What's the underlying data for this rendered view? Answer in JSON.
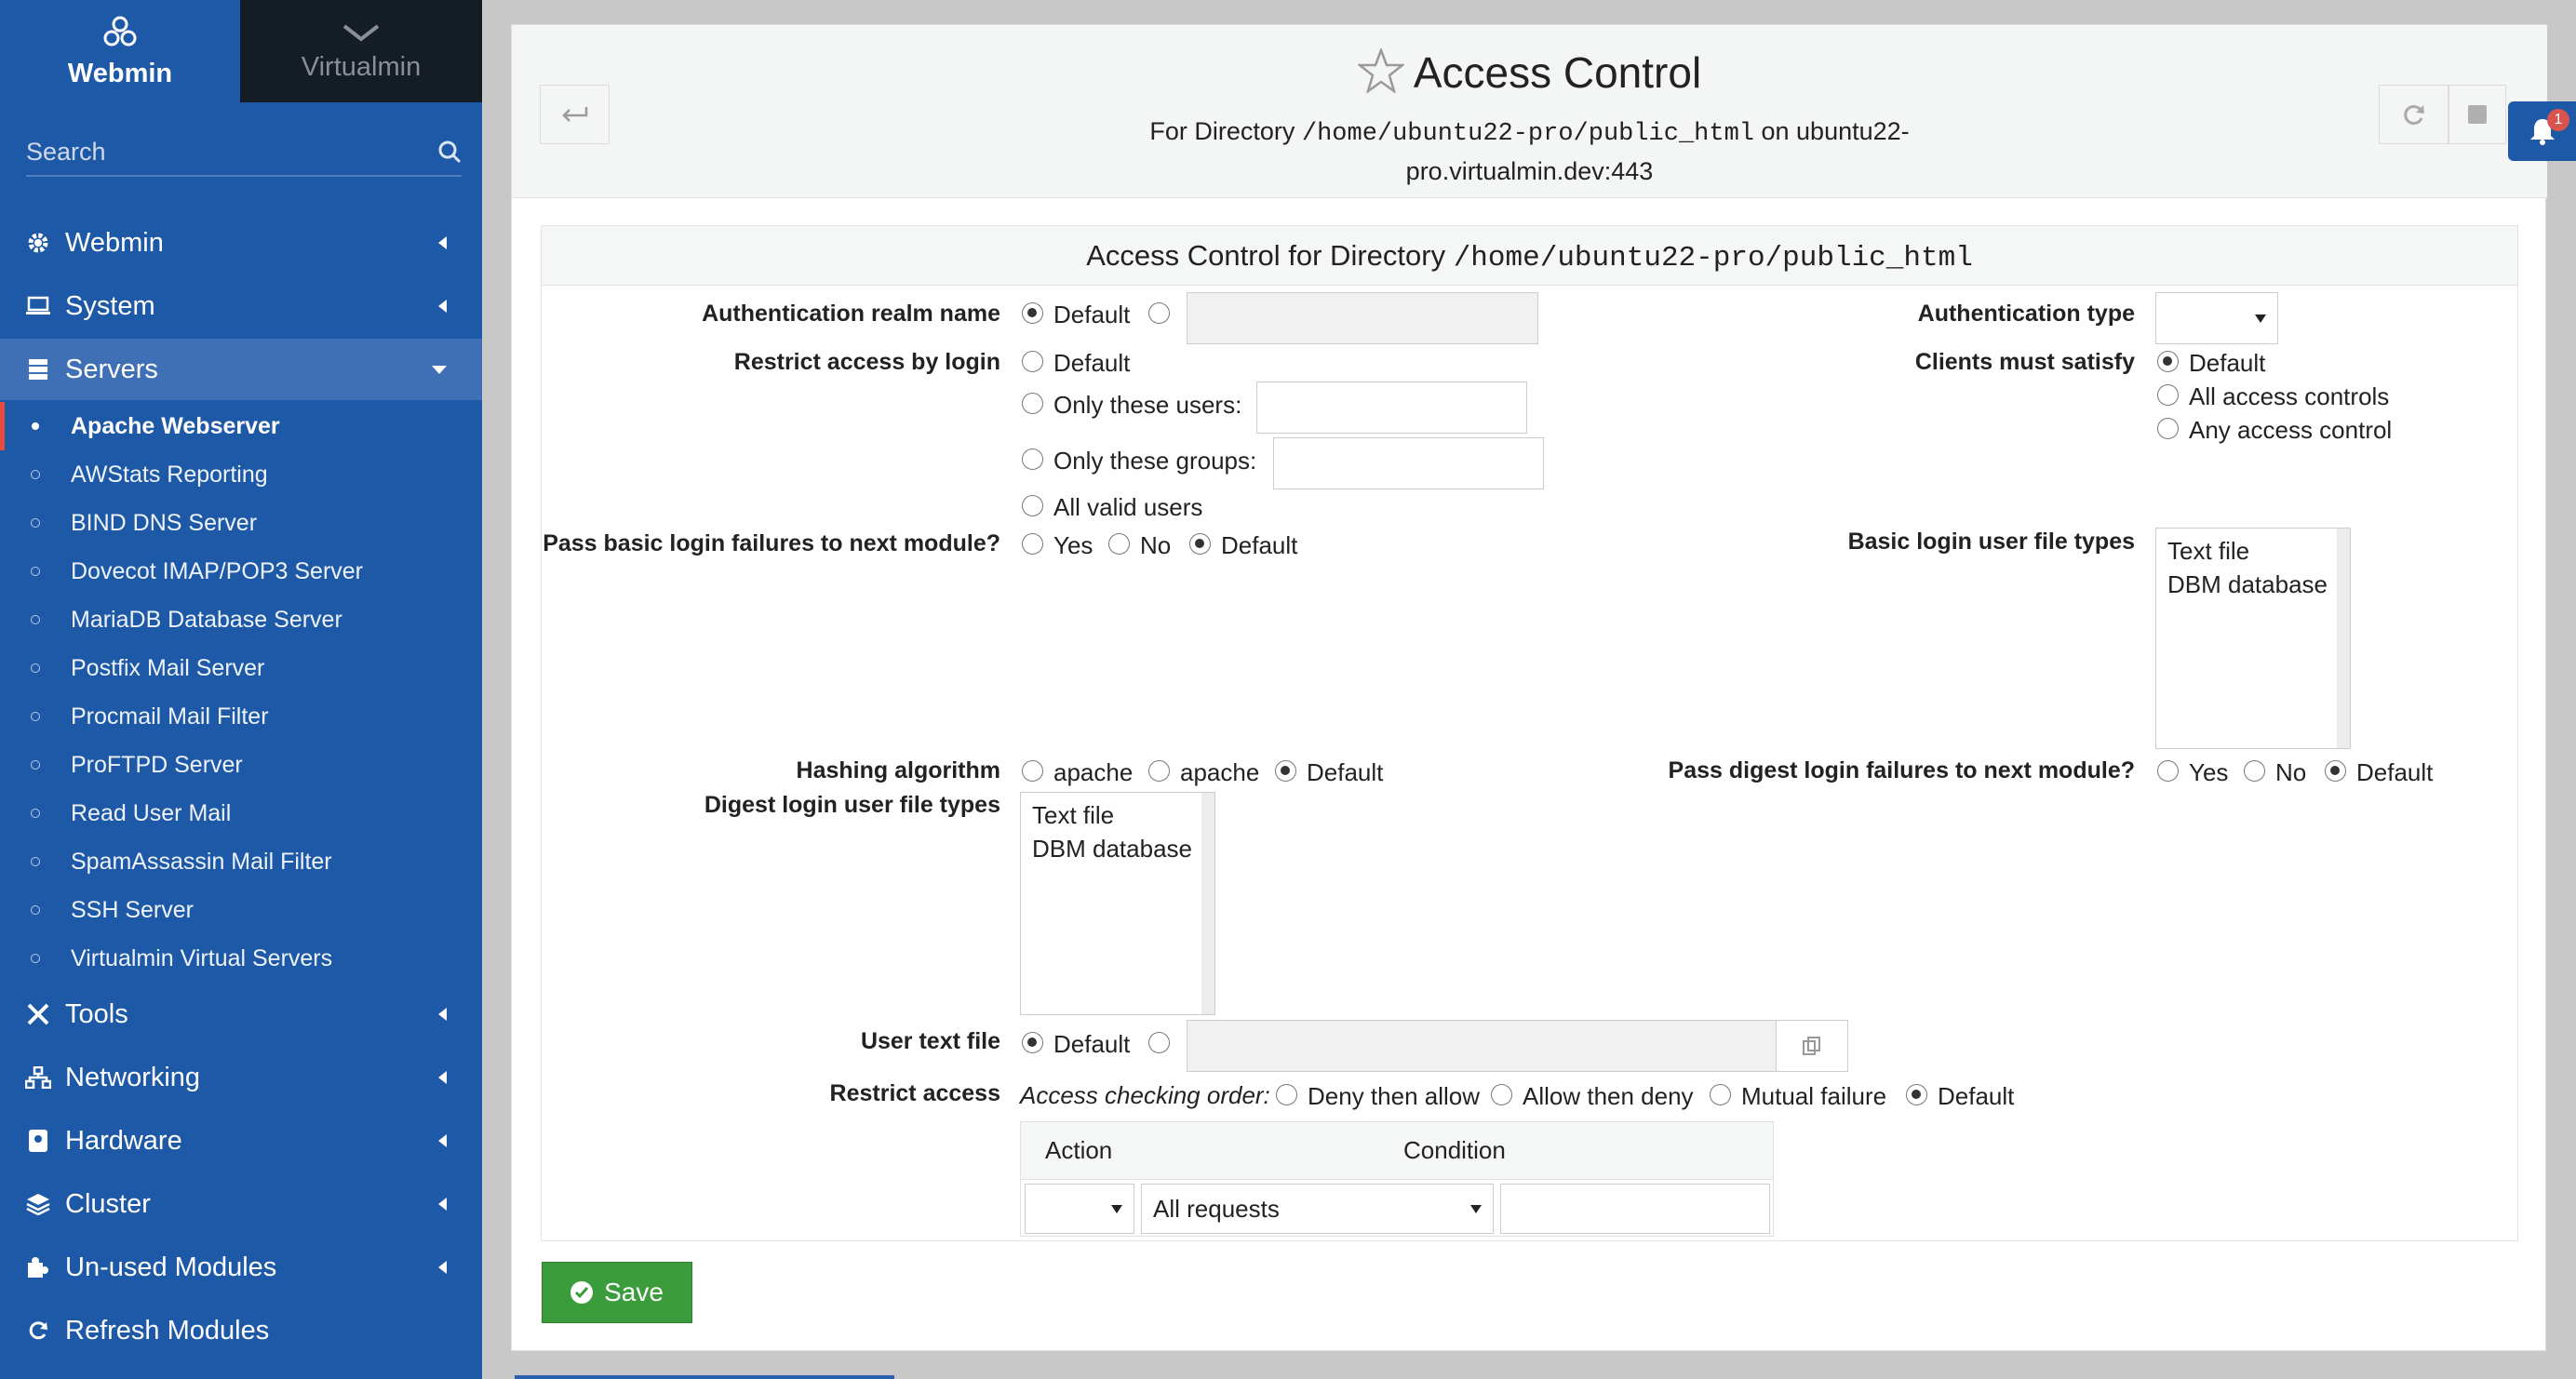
{
  "sidebar": {
    "switcher": {
      "webmin": "Webmin",
      "virtualmin": "Virtualmin"
    },
    "search_placeholder": "Search",
    "categories": [
      {
        "label": "Webmin",
        "icon": "gear-icon"
      },
      {
        "label": "System",
        "icon": "laptop-icon"
      },
      {
        "label": "Servers",
        "icon": "server-icon"
      },
      {
        "label": "Tools",
        "icon": "tools-icon"
      },
      {
        "label": "Networking",
        "icon": "network-icon"
      },
      {
        "label": "Hardware",
        "icon": "hdd-icon"
      },
      {
        "label": "Cluster",
        "icon": "layers-icon"
      },
      {
        "label": "Un-used Modules",
        "icon": "puzzle-icon"
      },
      {
        "label": "Refresh Modules",
        "icon": "refresh-icon"
      }
    ],
    "servers_modules": [
      "Apache Webserver",
      "AWStats Reporting",
      "BIND DNS Server",
      "Dovecot IMAP/POP3 Server",
      "MariaDB Database Server",
      "Postfix Mail Server",
      "Procmail Mail Filter",
      "ProFTPD Server",
      "Read User Mail",
      "SpamAssassin Mail Filter",
      "SSH Server",
      "Virtualmin Virtual Servers"
    ],
    "active_module": "Apache Webserver"
  },
  "header": {
    "title": "Access Control",
    "subtitle_prefix": "For Directory",
    "subtitle_path": "/home/ubuntu22-pro/public_html",
    "subtitle_on": "on ubuntu22-",
    "subtitle_host": "pro.virtualmin.dev:443",
    "notification_count": "1"
  },
  "panel": {
    "title_prefix": "Access Control for Directory",
    "title_path": "/home/ubuntu22-pro/public_html",
    "realm": {
      "label": "Authentication realm name",
      "opt_default": "Default",
      "value": ""
    },
    "auth_type": {
      "label": "Authentication type",
      "value": ""
    },
    "restrict_login": {
      "label": "Restrict access by login",
      "opt_default": "Default",
      "opt_users": "Only these users:",
      "opt_groups": "Only these groups:",
      "opt_valid": "All valid users",
      "users_value": "",
      "groups_value": ""
    },
    "clients_satisfy": {
      "label": "Clients must satisfy",
      "opt_default": "Default",
      "opt_all": "All access controls",
      "opt_any": "Any access control"
    },
    "basic_fail": {
      "label": "Pass basic login failures to next module?",
      "yes": "Yes",
      "no": "No",
      "default": "Default"
    },
    "basic_filetypes": {
      "label": "Basic login user file types",
      "options": [
        "Text file",
        "DBM database"
      ]
    },
    "hashing": {
      "label": "Hashing algorithm",
      "opt1": "apache",
      "opt2": "apache",
      "default": "Default"
    },
    "digest_fail": {
      "label": "Pass digest login failures to next module?",
      "yes": "Yes",
      "no": "No",
      "default": "Default"
    },
    "digest_filetypes": {
      "label": "Digest login user file types",
      "options": [
        "Text file",
        "DBM database"
      ]
    },
    "user_text_file": {
      "label": "User text file",
      "opt_default": "Default",
      "value": ""
    },
    "restrict_access": {
      "label": "Restrict access",
      "order_label": "Access checking order:",
      "opt_deny_allow": "Deny then allow",
      "opt_allow_deny": "Allow then deny",
      "opt_mutual": "Mutual failure",
      "opt_default": "Default",
      "col_action": "Action",
      "col_condition": "Condition",
      "row_action": "",
      "row_condition": "All requests",
      "row_value": ""
    }
  },
  "save_label": "Save"
}
